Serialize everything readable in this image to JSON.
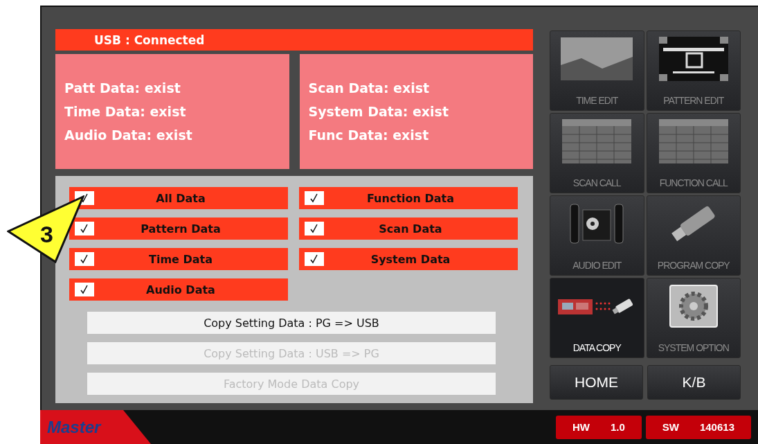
{
  "usb_status": "USB : Connected",
  "data_status_left": [
    "Patt Data: exist",
    "Time Data: exist",
    "Audio Data: exist"
  ],
  "data_status_right": [
    "Scan Data: exist",
    "System Data: exist",
    "Func Data: exist"
  ],
  "options": [
    {
      "label": "All Data",
      "checked": true
    },
    {
      "label": "Function Data",
      "checked": true
    },
    {
      "label": "Pattern Data",
      "checked": true
    },
    {
      "label": "Scan Data",
      "checked": true
    },
    {
      "label": "Time Data",
      "checked": true
    },
    {
      "label": "System Data",
      "checked": true
    },
    {
      "label": "Audio Data",
      "checked": true
    }
  ],
  "actions": [
    {
      "label": "Copy Setting Data : PG => USB",
      "disabled": false
    },
    {
      "label": "Copy Setting Data : USB => PG",
      "disabled": true
    },
    {
      "label": "Factory Mode Data Copy",
      "disabled": true
    }
  ],
  "menu": [
    {
      "kind": "photo",
      "label": "TIME EDIT",
      "selected": false
    },
    {
      "kind": "pattern",
      "label": "PATTERN EDIT",
      "selected": false
    },
    {
      "kind": "table",
      "label": "SCAN CALL",
      "selected": false
    },
    {
      "kind": "table",
      "label": "FUNCTION CALL",
      "selected": false
    },
    {
      "kind": "speakers",
      "label": "AUDIO EDIT",
      "selected": false
    },
    {
      "kind": "usb",
      "label": "PROGRAM COPY",
      "selected": false
    },
    {
      "kind": "device",
      "label": "DATA COPY",
      "selected": true
    },
    {
      "kind": "gear",
      "label": "SYSTEM OPTION",
      "selected": false
    }
  ],
  "nav_buttons": [
    "HOME",
    "K/B"
  ],
  "versions": [
    {
      "name": "HW",
      "value": "1.0"
    },
    {
      "name": "SW",
      "value": "140613"
    }
  ],
  "logo": "Master",
  "callout": "3"
}
